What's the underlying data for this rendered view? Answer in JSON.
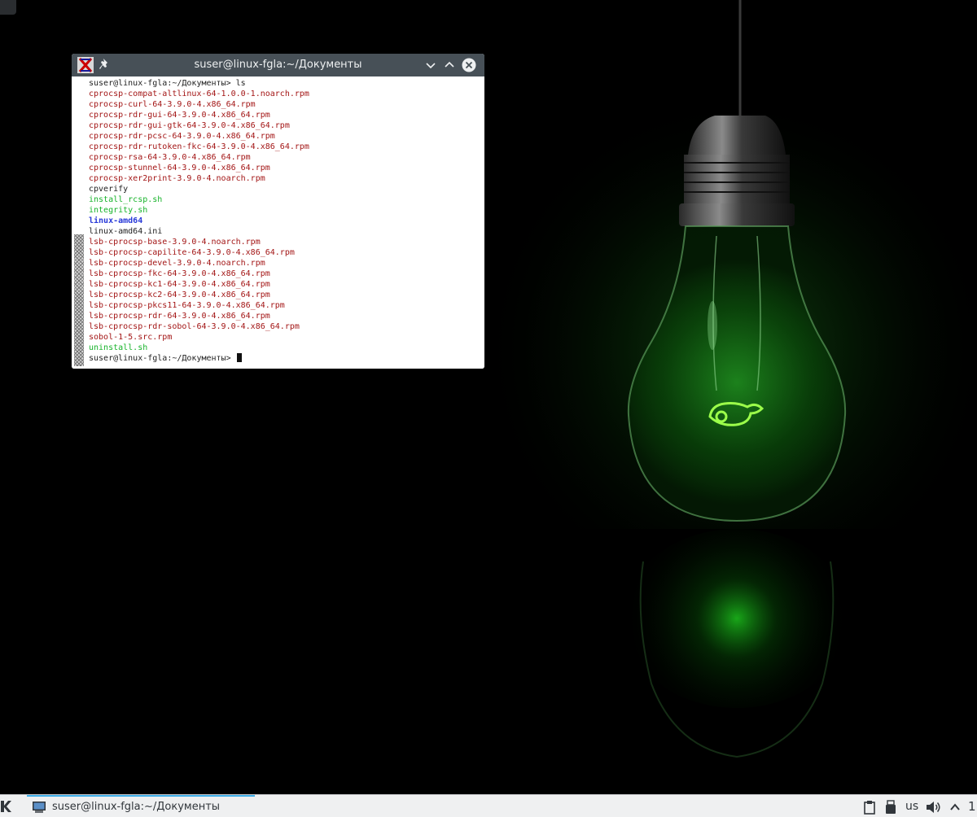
{
  "window": {
    "title": "suser@linux-fgla:~/Документы"
  },
  "terminal": {
    "lines": [
      {
        "text": "suser@linux-fgla:~/Документы> ls",
        "type": "plain"
      },
      {
        "text": "cprocsp-compat-altlinux-64-1.0.0-1.noarch.rpm",
        "type": "rpm"
      },
      {
        "text": "cprocsp-curl-64-3.9.0-4.x86_64.rpm",
        "type": "rpm"
      },
      {
        "text": "cprocsp-rdr-gui-64-3.9.0-4.x86_64.rpm",
        "type": "rpm"
      },
      {
        "text": "cprocsp-rdr-gui-gtk-64-3.9.0-4.x86_64.rpm",
        "type": "rpm"
      },
      {
        "text": "cprocsp-rdr-pcsc-64-3.9.0-4.x86_64.rpm",
        "type": "rpm"
      },
      {
        "text": "cprocsp-rdr-rutoken-fkc-64-3.9.0-4.x86_64.rpm",
        "type": "rpm"
      },
      {
        "text": "cprocsp-rsa-64-3.9.0-4.x86_64.rpm",
        "type": "rpm"
      },
      {
        "text": "cprocsp-stunnel-64-3.9.0-4.x86_64.rpm",
        "type": "rpm"
      },
      {
        "text": "cprocsp-xer2print-3.9.0-4.noarch.rpm",
        "type": "rpm"
      },
      {
        "text": "cpverify",
        "type": "plain"
      },
      {
        "text": "install_rcsp.sh",
        "type": "exec"
      },
      {
        "text": "integrity.sh",
        "type": "exec"
      },
      {
        "text": "linux-amd64",
        "type": "dir"
      },
      {
        "text": "linux-amd64.ini",
        "type": "plain"
      },
      {
        "text": "lsb-cprocsp-base-3.9.0-4.noarch.rpm",
        "type": "rpm"
      },
      {
        "text": "lsb-cprocsp-capilite-64-3.9.0-4.x86_64.rpm",
        "type": "rpm"
      },
      {
        "text": "lsb-cprocsp-devel-3.9.0-4.noarch.rpm",
        "type": "rpm"
      },
      {
        "text": "lsb-cprocsp-fkc-64-3.9.0-4.x86_64.rpm",
        "type": "rpm"
      },
      {
        "text": "lsb-cprocsp-kc1-64-3.9.0-4.x86_64.rpm",
        "type": "rpm"
      },
      {
        "text": "lsb-cprocsp-kc2-64-3.9.0-4.x86_64.rpm",
        "type": "rpm"
      },
      {
        "text": "lsb-cprocsp-pkcs11-64-3.9.0-4.x86_64.rpm",
        "type": "rpm"
      },
      {
        "text": "lsb-cprocsp-rdr-64-3.9.0-4.x86_64.rpm",
        "type": "rpm"
      },
      {
        "text": "lsb-cprocsp-rdr-sobol-64-3.9.0-4.x86_64.rpm",
        "type": "rpm"
      },
      {
        "text": "sobol-1-5.src.rpm",
        "type": "rpm"
      },
      {
        "text": "uninstall.sh",
        "type": "exec"
      },
      {
        "text": "suser@linux-fgla:~/Документы> ",
        "type": "prompt"
      }
    ]
  },
  "taskbar": {
    "task_label": "suser@linux-fgla:~/Документы",
    "keyboard_layout": "us",
    "clock_partial": "1"
  },
  "colors": {
    "rpm": "#a31515",
    "exec": "#17b32a",
    "dir": "#2839d8",
    "titlebar": "#475057",
    "accent": "#3daee9"
  },
  "icons": {
    "app": "xterm-icon",
    "pin": "pin-icon",
    "minimize": "chevron-down-icon",
    "maximize": "chevron-up-icon",
    "close": "close-icon",
    "launcher": "kde-launcher-icon",
    "task": "terminal-icon",
    "clipboard": "clipboard-icon",
    "device": "usb-device-icon",
    "volume": "volume-icon",
    "expand": "chevron-up-icon"
  }
}
